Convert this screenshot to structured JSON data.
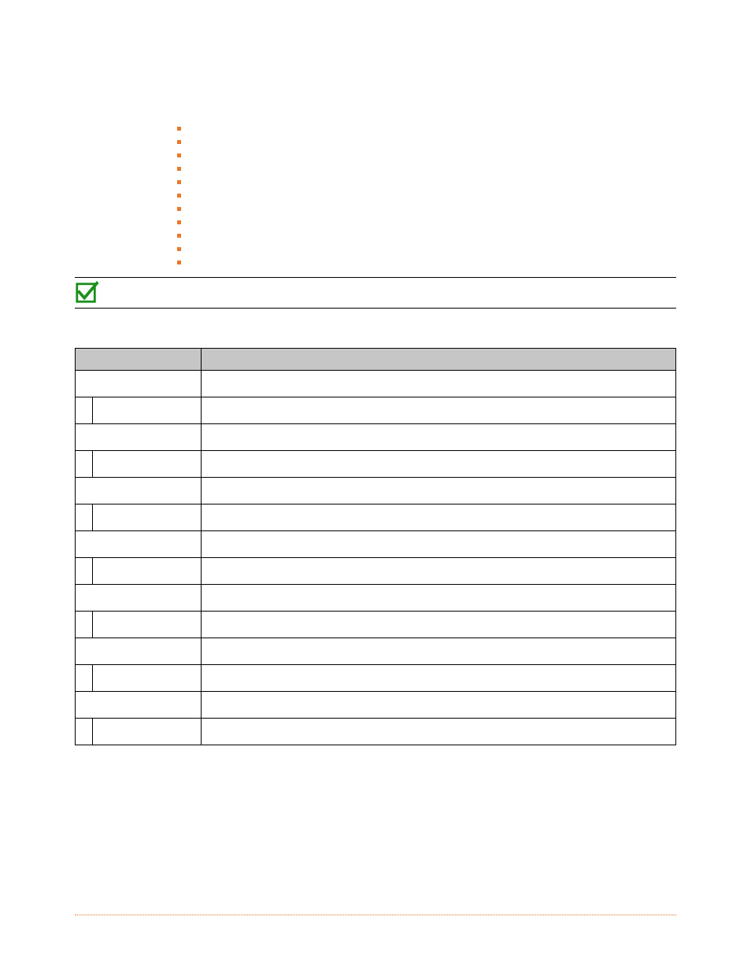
{
  "bullets": [
    "",
    "",
    "",
    "",
    "",
    "",
    "",
    "",
    "",
    "",
    ""
  ],
  "heading": {
    "title": ""
  },
  "table": {
    "headers": [
      "",
      ""
    ],
    "rows": [
      {
        "type": "full",
        "a": "",
        "b": ""
      },
      {
        "type": "indent",
        "a": "",
        "b": ""
      },
      {
        "type": "full",
        "a": "",
        "b": ""
      },
      {
        "type": "indent",
        "a": "",
        "b": ""
      },
      {
        "type": "full",
        "a": "",
        "b": ""
      },
      {
        "type": "indent",
        "a": "",
        "b": ""
      },
      {
        "type": "full",
        "a": "",
        "b": ""
      },
      {
        "type": "indent",
        "a": "",
        "b": ""
      },
      {
        "type": "full",
        "a": "",
        "b": ""
      },
      {
        "type": "indent",
        "a": "",
        "b": ""
      },
      {
        "type": "full",
        "a": "",
        "b": ""
      },
      {
        "type": "indent",
        "a": "",
        "b": ""
      },
      {
        "type": "full",
        "a": "",
        "b": ""
      },
      {
        "type": "indent",
        "a": "",
        "b": ""
      }
    ]
  },
  "colors": {
    "accent_orange": "#e77a2a",
    "check_green": "#1a8f1a",
    "header_gray": "#c6c6c6"
  }
}
